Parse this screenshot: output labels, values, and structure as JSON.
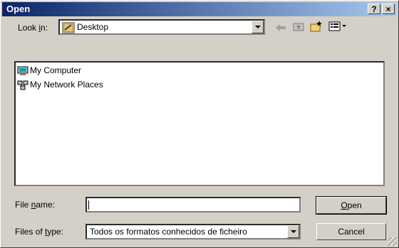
{
  "window": {
    "title": "Open",
    "help": "?",
    "close": "×"
  },
  "lookin": {
    "label_pre": "Look ",
    "label_key": "i",
    "label_post": "n:",
    "value": "Desktop"
  },
  "items": [
    {
      "label": "My Computer",
      "icon": "computer-icon"
    },
    {
      "label": "My Network Places",
      "icon": "network-places-icon"
    }
  ],
  "filename": {
    "label_pre": "File ",
    "label_key": "n",
    "label_post": "ame:",
    "value": ""
  },
  "filetype": {
    "label_pre": "Files of ",
    "label_key": "t",
    "label_post": "ype:",
    "value": "Todos os formatos conhecidos de ficheiro"
  },
  "buttons": {
    "open_key": "O",
    "open_rest": "pen",
    "cancel": "Cancel"
  },
  "icons": [
    "back-icon",
    "up-folder-icon",
    "new-folder-icon",
    "view-menu-icon"
  ]
}
